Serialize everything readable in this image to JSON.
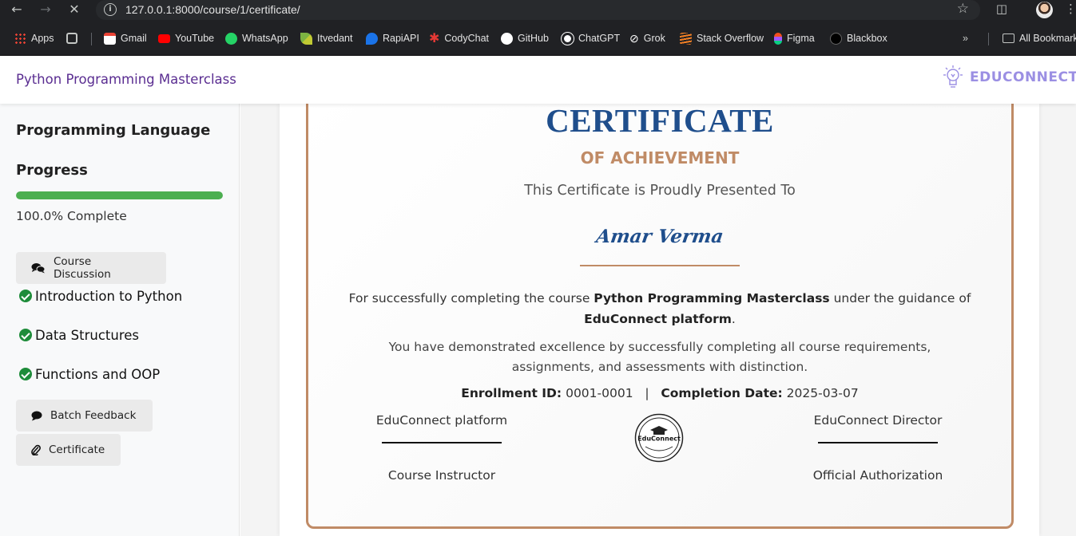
{
  "browser": {
    "url": "127.0.0.1:8000/course/1/certificate/",
    "bookmarks": [
      {
        "label": "Apps",
        "icon": "apps-grid-icon",
        "color": "#4285f4"
      },
      {
        "label": "Gmail",
        "icon": "gmail-icon",
        "color": "#ea4335"
      },
      {
        "label": "YouTube",
        "icon": "youtube-icon",
        "color": "#ff0000"
      },
      {
        "label": "WhatsApp",
        "icon": "whatsapp-icon",
        "color": "#25d366"
      },
      {
        "label": "Itvedant",
        "icon": "itvedant-icon",
        "color": "#7cb342"
      },
      {
        "label": "RapiAPI",
        "icon": "rapidapi-icon",
        "color": "#1a73e8"
      },
      {
        "label": "CodyChat",
        "icon": "codychat-icon",
        "color": "#e53935"
      },
      {
        "label": "GitHub",
        "icon": "github-icon",
        "color": "#ffffff"
      },
      {
        "label": "ChatGPT",
        "icon": "chatgpt-icon",
        "color": "#ffffff"
      },
      {
        "label": "Grok",
        "icon": "grok-icon",
        "color": "#ffffff"
      },
      {
        "label": "Stack Overflow",
        "icon": "stackoverflow-icon",
        "color": "#f48024"
      },
      {
        "label": "Figma",
        "icon": "figma-icon",
        "color": "#a259ff"
      },
      {
        "label": "Blackbox",
        "icon": "blackbox-icon",
        "color": "#111111"
      }
    ],
    "all_bookmarks": "All Bookmarks"
  },
  "header": {
    "course_title": "Python Programming Masterclass",
    "brand": "EDUCONNECT"
  },
  "sidebar": {
    "category": "Programming Language",
    "progress_heading": "Progress",
    "progress_fraction": 1.0,
    "progress_text": "100.0% Complete",
    "discussion_button": "Course Discussion",
    "lessons": [
      {
        "label": "Introduction to Python",
        "completed": true
      },
      {
        "label": "Data Structures",
        "completed": true
      },
      {
        "label": "Functions and OOP",
        "completed": true
      }
    ],
    "feedback_button": "Batch Feedback",
    "certificate_button": "Certificate"
  },
  "certificate": {
    "title": "CERTIFICATE",
    "subtitle": "OF ACHIEVEMENT",
    "presented_to": "This Certificate is Proudly Presented To",
    "recipient": "Amar Verma",
    "line1_prefix": "For successfully completing the course ",
    "course_name": "Python Programming Masterclass",
    "line1_middle": " under the guidance of",
    "platform": "EduConnect platform",
    "line1_suffix": ".",
    "excellence_text": "You have demonstrated excellence by successfully completing all course requirements, assignments, and assessments with distinction.",
    "enrollment_label": "Enrollment ID:",
    "enrollment_id": "0001-0001",
    "separator": "|",
    "completion_label": "Completion Date:",
    "completion_date": "2025-03-07",
    "left_signer": "EduConnect platform",
    "left_role": "Course Instructor",
    "right_signer": "EduConnect Director",
    "right_role": "Official Authorization",
    "seal_text": "EduConnect"
  }
}
